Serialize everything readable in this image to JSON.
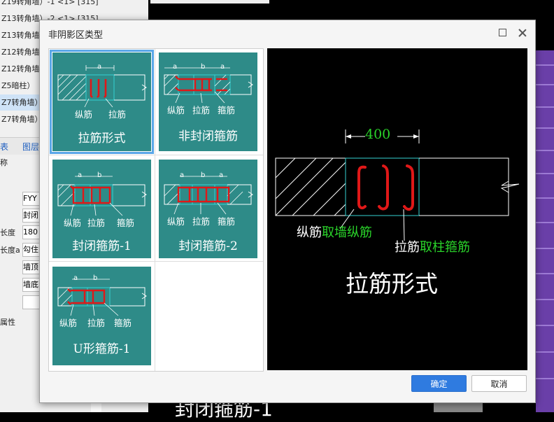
{
  "background": {
    "tree_items": [
      {
        "label": "Z19转角墙）-1 <1> [315]",
        "selected": false
      },
      {
        "label": "Z13转角墙）-2 <1> [315]",
        "selected": false
      },
      {
        "label": "Z13转角墙）",
        "selected": false
      },
      {
        "label": "Z12转角墙）",
        "selected": false
      },
      {
        "label": "Z12转角墙）",
        "selected": false
      },
      {
        "label": "Z5暗柱）",
        "selected": false
      },
      {
        "label": "Z7转角墙）",
        "selected": true
      },
      {
        "label": "Z7转角墙）",
        "selected": false
      }
    ],
    "tabs": [
      "表",
      "图层"
    ],
    "prop_header": "称",
    "props": [
      {
        "label": "",
        "value": "FYY"
      },
      {
        "label": "",
        "value": "封闭"
      },
      {
        "label": "长度",
        "value": "180"
      },
      {
        "label": "长度a",
        "value": "勾住"
      },
      {
        "label": "",
        "value": "墙顶"
      },
      {
        "label": "",
        "value": "墙底"
      },
      {
        "label": "",
        "value": ""
      }
    ],
    "section_label": "属性",
    "bottom_text": "封闭箍筋-1"
  },
  "dialog": {
    "title": "非阴影区类型",
    "ok_label": "确定",
    "cancel_label": "取消"
  },
  "types": [
    {
      "caption": "拉筋形式",
      "dims": [
        "a"
      ],
      "labels": [
        "纵筋",
        "拉筋"
      ],
      "selected": true
    },
    {
      "caption": "非封闭箍筋",
      "dims": [
        "a",
        "b",
        "a"
      ],
      "labels": [
        "纵筋",
        "拉筋",
        "箍筋"
      ],
      "selected": false
    },
    {
      "caption": "封闭箍筋-1",
      "dims": [
        "a",
        "b"
      ],
      "labels": [
        "纵筋",
        "拉筋",
        "箍筋"
      ],
      "selected": false
    },
    {
      "caption": "封闭箍筋-2",
      "dims": [
        "a",
        "b",
        "a"
      ],
      "labels": [
        "纵筋",
        "拉筋",
        "箍筋"
      ],
      "selected": false
    },
    {
      "caption": "U形箍筋-1",
      "dims": [
        "a",
        "b"
      ],
      "labels": [
        "纵筋",
        "拉筋",
        "箍筋"
      ],
      "selected": false
    }
  ],
  "preview": {
    "dimension": "400",
    "label1_white": "纵筋",
    "label1_green": "取墙纵筋",
    "label2_white": "拉筋",
    "label2_green": "取柱箍筋",
    "title": "拉筋形式"
  },
  "colors": {
    "card_bg": "#2e8b88",
    "rebar_red": "#e01818",
    "green_text": "#2ad42a",
    "primary_button": "#2f7be0"
  }
}
